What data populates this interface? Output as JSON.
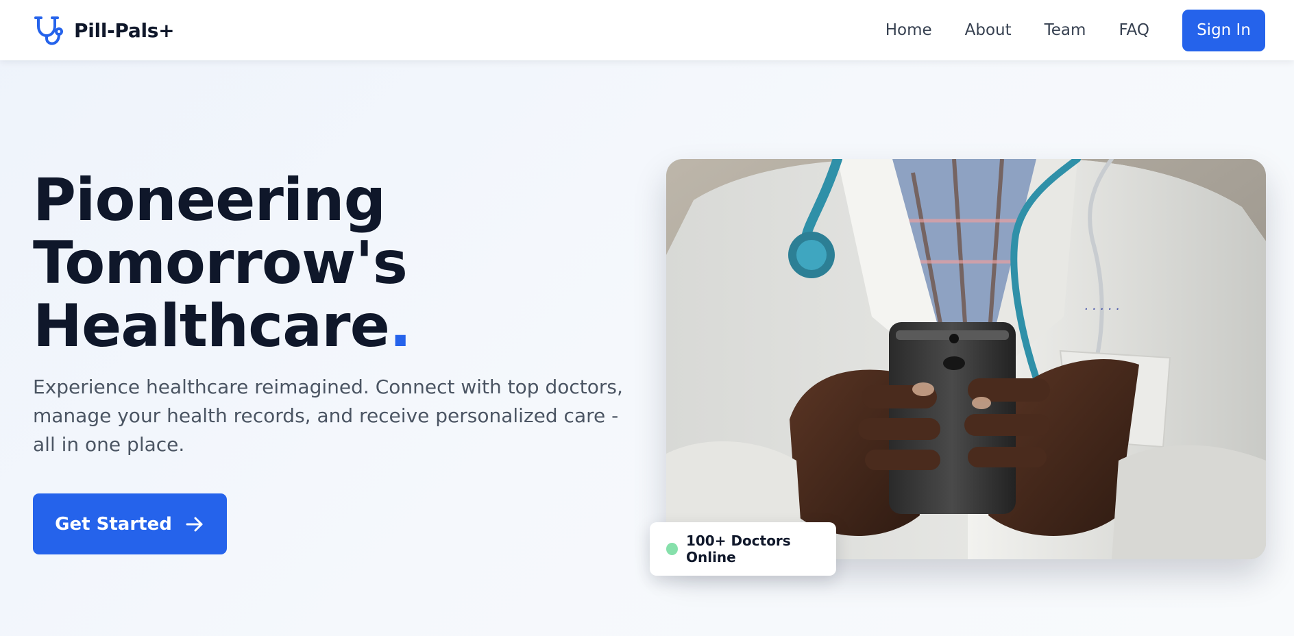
{
  "brand": {
    "name": "Pill-Pals+",
    "icon": "stethoscope-icon",
    "accent_color": "#2563eb"
  },
  "nav": {
    "links": [
      "Home",
      "About",
      "Team",
      "FAQ"
    ],
    "signin_label": "Sign In"
  },
  "hero": {
    "title_lines": [
      "Pioneering",
      "Tomorrow's",
      "Healthcare"
    ],
    "title_dot": ".",
    "description": "Experience healthcare reimagined. Connect with top doctors, manage your health records, and receive personalized care - all in one place.",
    "cta_label": "Get Started",
    "cta_icon": "arrow-right-icon"
  },
  "photo": {
    "subject": "doctor-holding-phone-photo"
  },
  "badge": {
    "text": "100+ Doctors Online",
    "status_color": "#86e0ab"
  }
}
